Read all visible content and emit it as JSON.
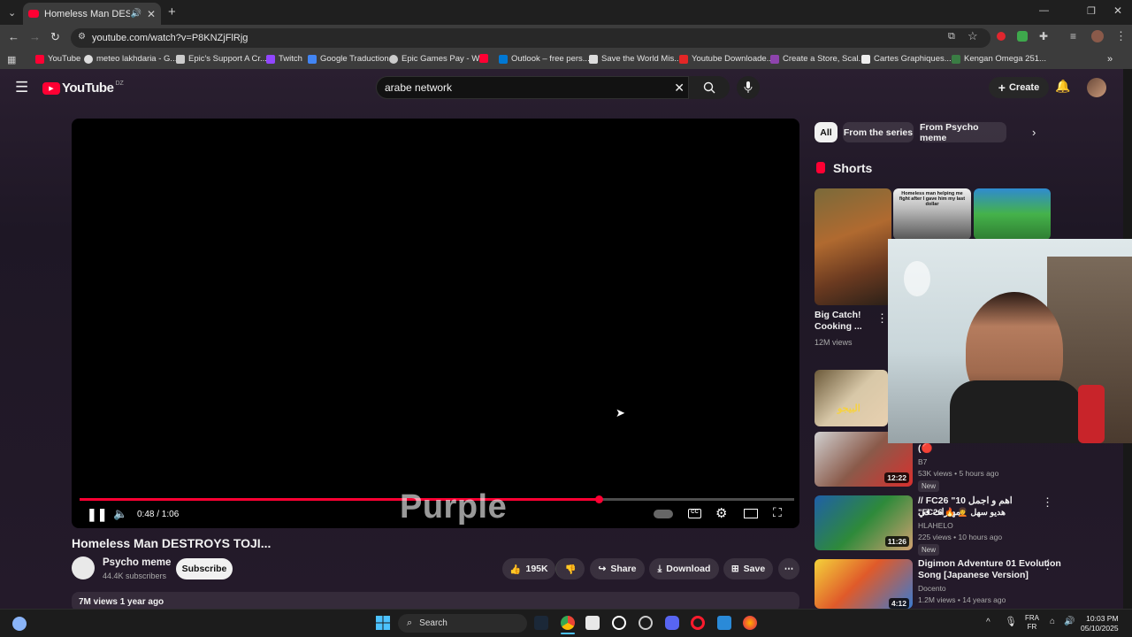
{
  "browser": {
    "tab_title": "Homeless Man DESTROYS T",
    "url": "youtube.com/watch?v=P8KNZjFlRjg",
    "bookmarks": [
      {
        "label": "YouTube",
        "color": "#ff0033"
      },
      {
        "label": "meteo lakhdaria - G...",
        "color": "#dddddd"
      },
      {
        "label": "Epic's Support A Cr...",
        "color": "#cccccc"
      },
      {
        "label": "Twitch",
        "color": "#9146ff"
      },
      {
        "label": "Google Traduction",
        "color": "#4285f4"
      },
      {
        "label": "Epic Games Pay - W...",
        "color": "#cccccc"
      },
      {
        "label": "",
        "color": "#ff0033"
      },
      {
        "label": "Outlook – free pers...",
        "color": "#0078d4"
      },
      {
        "label": "Save the World Mis...",
        "color": "#dddddd"
      },
      {
        "label": "Youtube Downloade...",
        "color": "#e32626"
      },
      {
        "label": "Create a Store, Scal...",
        "color": "#8e44ad"
      },
      {
        "label": "Cartes Graphiques...",
        "color": "#eeeeee"
      },
      {
        "label": "Kengan Omega 251...",
        "color": "#3a7d44"
      }
    ]
  },
  "youtube": {
    "logo_text": "YouTube",
    "country_code": "DZ",
    "search_value": "arabe network",
    "create_label": "Create"
  },
  "player": {
    "time": "0:48 / 1:06",
    "progress_fraction": 0.727,
    "overlay_text": "Purple"
  },
  "video": {
    "title": "Homeless Man DESTROYS TOJI...",
    "channel": "Psycho meme",
    "subscribers": "44.4K subscribers",
    "subscribe_label": "Subscribe",
    "likes": "195K",
    "share_label": "Share",
    "download_label": "Download",
    "save_label": "Save",
    "views_date": "7M views  1 year ago"
  },
  "sidebar": {
    "chips": [
      "All",
      "From the series",
      "From Psycho meme"
    ],
    "shorts_heading": "Shorts",
    "shorts": [
      {
        "title": "Big Catch! Cooking ...",
        "views": "12M views",
        "caption": ""
      },
      {
        "title": "",
        "views": "",
        "caption": "Homeless man helping me fight after I gave him my last dollar"
      }
    ],
    "videos": [
      {
        "title": "(🔴",
        "channel": "B7",
        "meta": "53K views • 5 hours ago",
        "badge": "New",
        "duration": "12:22"
      },
      {
        "title": "// FC26 \"اهم و اجمل 10 مهارات في",
        "title2": "\"FC26 🔥 🧑‍🦱 هديو سهل",
        "channel": "HLAHELO",
        "meta": "225 views • 10 hours ago",
        "badge": "New",
        "duration": "11:26"
      },
      {
        "title": "Digimon Adventure 01 Evolution",
        "title2": "Song [Japanese Version]",
        "channel": "Docento",
        "meta": "1.2M views • 14 years ago",
        "badge": "",
        "duration": "4:12"
      }
    ],
    "short_thumb_caption": "البيجو"
  },
  "taskbar": {
    "search_label": "Search",
    "lang_line1": "FRA",
    "lang_line2": "FR",
    "clock_time": "10:03 PM",
    "clock_date": "05/10/2025"
  },
  "colors": {
    "accent": "#ff0033",
    "page_bg": "#0f0f0f"
  }
}
